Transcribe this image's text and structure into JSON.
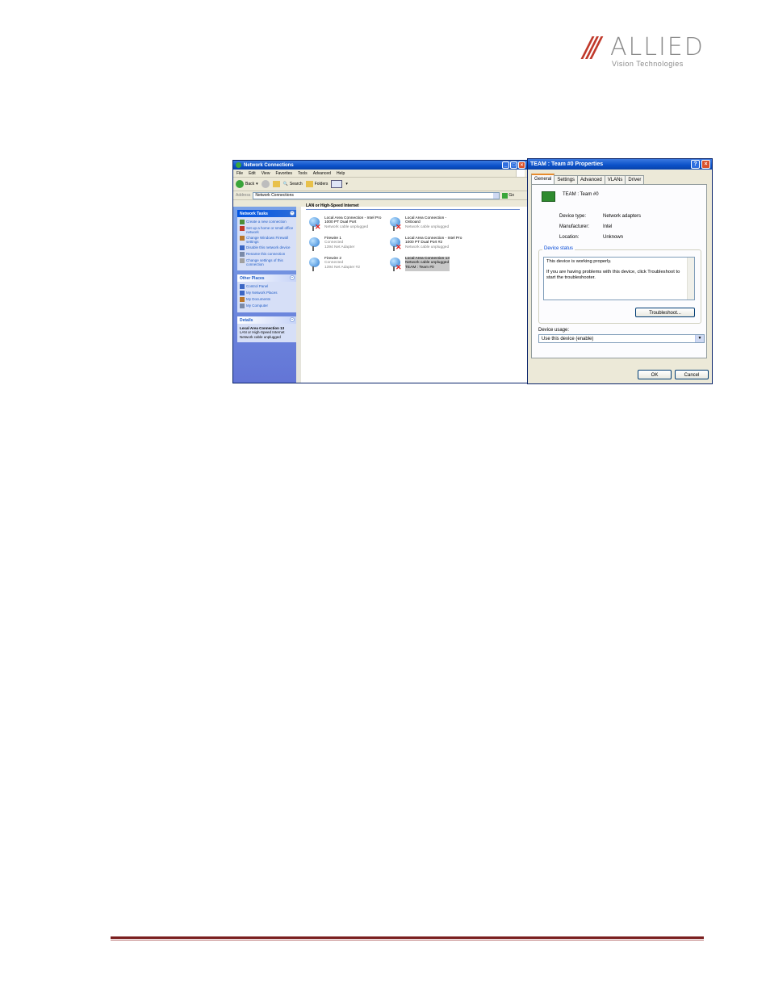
{
  "logo": {
    "slashes": "///",
    "name": "ALLIED",
    "tagline": "Vision Technologies"
  },
  "explorer": {
    "title": "Network Connections",
    "menu": [
      "File",
      "Edit",
      "View",
      "Favorites",
      "Tools",
      "Advanced",
      "Help"
    ],
    "toolbar": {
      "back": "Back",
      "search": "Search",
      "folders": "Folders"
    },
    "address": {
      "label": "Address",
      "value": "Network Connections",
      "go": "Go"
    },
    "network_tasks": {
      "title": "Network Tasks",
      "items": [
        "Create a new connection",
        "Set up a home or small office network",
        "Change Windows Firewall settings",
        "Disable this network device",
        "Rename this connection",
        "Change settings of this connection"
      ]
    },
    "other_places": {
      "title": "Other Places",
      "items": [
        "Control Panel",
        "My Network Places",
        "My Documents",
        "My Computer"
      ]
    },
    "details": {
      "title": "Details",
      "name": "Local Area Connection 13",
      "type": "LAN or High-Speed Internet",
      "status": "Network cable unplugged"
    },
    "group_title": "LAN or High-Speed Internet",
    "connections": [
      {
        "name": "Local Area Connection - Intel Pro",
        "line2": "1000 PT Dual Port",
        "line3": "Network cable unplugged"
      },
      {
        "name": "Local Area Connection -",
        "line2": "Onboard",
        "line3": "Network cable unplugged"
      },
      {
        "name": "Firewire 1",
        "line2": "Connected",
        "line3": "1394 Net Adapter"
      },
      {
        "name": "Local Area Connection - Intel Pro",
        "line2": "1000 PT Dual Port #2",
        "line3": "Network cable unplugged"
      },
      {
        "name": "Firewire 2",
        "line2": "Connected",
        "line3": "1394 Net Adapter #2"
      },
      {
        "name": "Local Area Connection 13",
        "line2": "Network cable unplugged",
        "line3": "TEAM : Team #0"
      }
    ]
  },
  "dialog": {
    "title": "TEAM : Team #0 Properties",
    "help_glyph": "?",
    "close_glyph": "×",
    "tabs": [
      "General",
      "Settings",
      "Advanced",
      "VLANs",
      "Driver"
    ],
    "device_name": "TEAM : Team #0",
    "props": [
      {
        "key": "Device type:",
        "value": "Network adapters"
      },
      {
        "key": "Manufacturer:",
        "value": "Intel"
      },
      {
        "key": "Location:",
        "value": "Unknown"
      }
    ],
    "status_legend": "Device status",
    "status_line1": "This device is working properly.",
    "status_line2": "If you are having problems with this device, click Troubleshoot to start the troubleshooter.",
    "troubleshoot": "Troubleshoot...",
    "usage_label": "Device usage:",
    "usage_value": "Use this device (enable)",
    "ok": "OK",
    "cancel": "Cancel"
  }
}
